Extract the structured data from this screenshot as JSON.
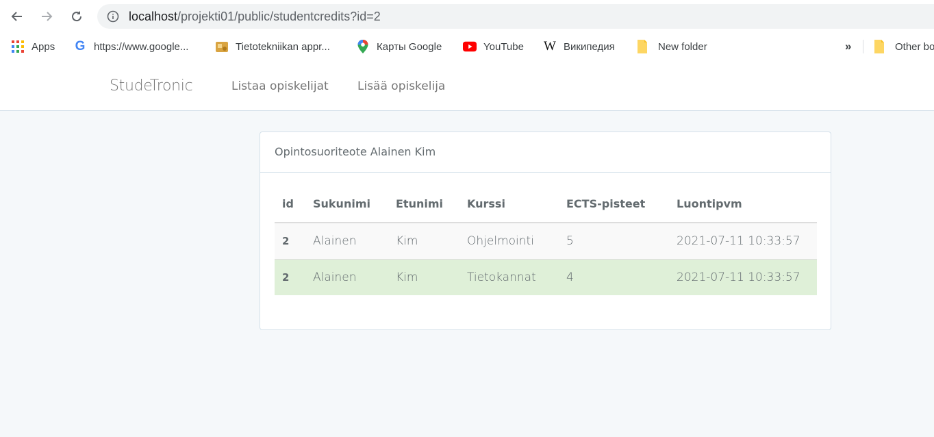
{
  "browser": {
    "url_host": "localhost",
    "url_path": "/projekti01/public/studentcredits?id=2",
    "bookmarks": [
      {
        "label": "Apps",
        "icon": "apps-grid-icon"
      },
      {
        "label": "https://www.google...",
        "icon": "google-icon"
      },
      {
        "label": "Tietotekniikan appr...",
        "icon": "bookmark-site-icon"
      },
      {
        "label": "Карты Google",
        "icon": "google-maps-icon"
      },
      {
        "label": "YouTube",
        "icon": "youtube-icon"
      },
      {
        "label": "Википедия",
        "icon": "wikipedia-icon"
      },
      {
        "label": "New folder",
        "icon": "folder-icon"
      }
    ],
    "overflow": "»",
    "other_bookmarks": "Other bo"
  },
  "app": {
    "brand": "StudeTronic",
    "nav": [
      "Listaa opiskelijat",
      "Lisää opiskelija"
    ]
  },
  "panel": {
    "heading": "Opintosuoriteote Alainen Kim",
    "columns": [
      "id",
      "Sukunimi",
      "Etunimi",
      "Kurssi",
      "ECTS-pisteet",
      "Luontipvm"
    ],
    "rows": [
      [
        "2",
        "Alainen",
        "Kim",
        "Ohjelmointi",
        "5",
        "2021-07-11 10:33:57"
      ],
      [
        "2",
        "Alainen",
        "Kim",
        "Tietokannat",
        "4",
        "2021-07-11 10:33:57"
      ]
    ]
  },
  "colors": {
    "page_bg": "#f5f8fa",
    "row_success": "#dff0d8",
    "row_odd": "#f9f9f9",
    "text": "#636b6f"
  }
}
